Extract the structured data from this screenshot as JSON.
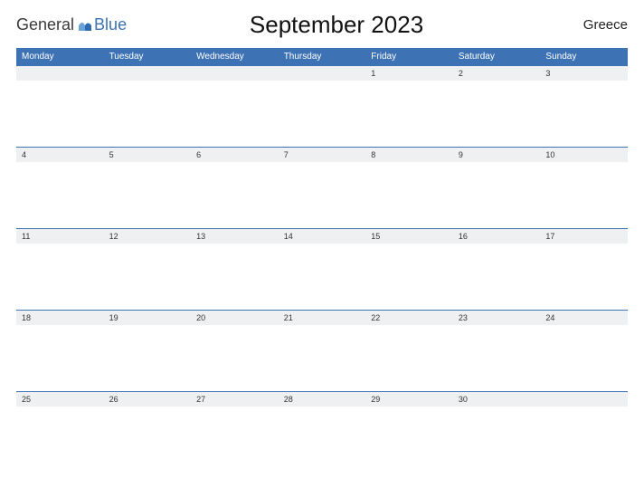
{
  "brand": {
    "general": "General",
    "blue": "Blue"
  },
  "title": "September 2023",
  "region": "Greece",
  "day_headers": [
    "Monday",
    "Tuesday",
    "Wednesday",
    "Thursday",
    "Friday",
    "Saturday",
    "Sunday"
  ],
  "weeks": [
    [
      "",
      "",
      "",
      "",
      "1",
      "2",
      "3"
    ],
    [
      "4",
      "5",
      "6",
      "7",
      "8",
      "9",
      "10"
    ],
    [
      "11",
      "12",
      "13",
      "14",
      "15",
      "16",
      "17"
    ],
    [
      "18",
      "19",
      "20",
      "21",
      "22",
      "23",
      "24"
    ],
    [
      "25",
      "26",
      "27",
      "28",
      "29",
      "30",
      ""
    ]
  ]
}
